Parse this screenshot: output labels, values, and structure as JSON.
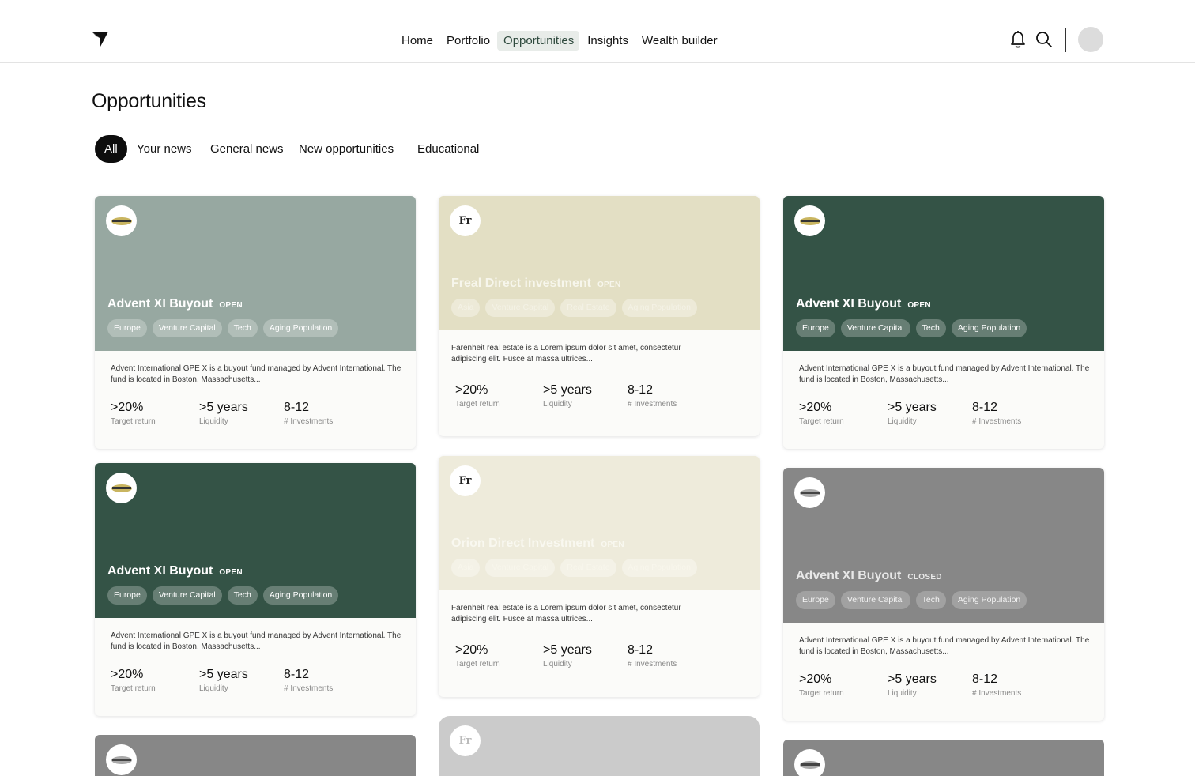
{
  "nav": {
    "items": [
      {
        "label": "Home",
        "active": false
      },
      {
        "label": "Portfolio",
        "active": false
      },
      {
        "label": "Opportunities",
        "active": true
      },
      {
        "label": "Insights",
        "active": false
      },
      {
        "label": "Wealth builder",
        "active": false
      }
    ],
    "icons": {
      "logo": "arrow-logo-icon",
      "notifications": "bell-icon",
      "search": "search-icon"
    }
  },
  "page": {
    "title": "Opportunities"
  },
  "filters": [
    {
      "label": "All",
      "active": true
    },
    {
      "label": "Your news",
      "active": false
    },
    {
      "label": "General news",
      "active": false
    },
    {
      "label": "New opportunities",
      "active": false
    },
    {
      "label": "Educational",
      "active": false
    }
  ],
  "cards": [
    {
      "title": "Advent XI Buyout",
      "status": "OPEN",
      "theme": "#97a8a1",
      "tags": [
        "Europe",
        "Venture Capital",
        "Tech",
        "Aging Population"
      ],
      "description": "Advent International GPE X is a buyout fund managed by Advent International. The fund is located in Boston, Massachusetts...",
      "stats": [
        {
          "value": ">20%",
          "label": "Target return"
        },
        {
          "value": ">5 years",
          "label": "Liquidity"
        },
        {
          "value": "8-12",
          "label": "# Investments"
        }
      ]
    },
    {
      "title": "Freal Direct investment",
      "status": "OPEN",
      "theme": "#e3dfc4",
      "logo_text": "Fr",
      "tags": [
        "Asia",
        "Venture Capital",
        "Real Estate",
        "Aging Population"
      ],
      "description": "Farenheit real estate is a Lorem ipsum dolor sit amet, consectetur adipiscing elit. Fusce at massa ultrices...",
      "stats": [
        {
          "value": ">20%",
          "label": "Target return"
        },
        {
          "value": ">5 years",
          "label": "Liquidity"
        },
        {
          "value": "8-12",
          "label": "# Investments"
        }
      ]
    },
    {
      "title": "Advent XI Buyout",
      "status": "OPEN",
      "theme": "#345346",
      "tags": [
        "Europe",
        "Venture Capital",
        "Tech",
        "Aging Population"
      ],
      "description": "Advent International GPE X is a buyout fund managed by Advent International. The fund is located in Boston, Massachusetts...",
      "stats": [
        {
          "value": ">20%",
          "label": "Target return"
        },
        {
          "value": ">5 years",
          "label": "Liquidity"
        },
        {
          "value": "8-12",
          "label": "# Investments"
        }
      ]
    },
    {
      "title": "Advent XI Buyout",
      "status": "OPEN",
      "theme": "#345346",
      "tags": [
        "Europe",
        "Venture Capital",
        "Tech",
        "Aging Population"
      ],
      "description": "Advent International GPE X is a buyout fund managed by Advent International. The fund is located in Boston, Massachusetts...",
      "stats": [
        {
          "value": ">20%",
          "label": "Target return"
        },
        {
          "value": ">5 years",
          "label": "Liquidity"
        },
        {
          "value": "8-12",
          "label": "# Investments"
        }
      ]
    },
    {
      "title": "Orion Direct Investment",
      "status": "OPEN",
      "theme": "#eeebdb",
      "logo_text": "Fr",
      "tags": [
        "Asia",
        "Venture Capital",
        "Real Estate",
        "Aging Population"
      ],
      "description": "Farenheit real estate is a Lorem ipsum dolor sit amet, consectetur adipiscing elit. Fusce at massa ultrices...",
      "stats": [
        {
          "value": ">20%",
          "label": "Target return"
        },
        {
          "value": ">5 years",
          "label": "Liquidity"
        },
        {
          "value": "8-12",
          "label": "# Investments"
        }
      ]
    },
    {
      "title": "Advent XI Buyout",
      "status": "CLOSED",
      "theme": "#878787",
      "tags": [
        "Europe",
        "Venture Capital",
        "Tech",
        "Aging Population"
      ],
      "description": "Advent International GPE X is a buyout fund managed by Advent International. The fund is located in Boston, Massachusetts...",
      "stats": [
        {
          "value": ">20%",
          "label": "Target return"
        },
        {
          "value": ">5 years",
          "label": "Liquidity"
        },
        {
          "value": "8-12",
          "label": "# Investments"
        }
      ]
    },
    {
      "theme": "#878787"
    },
    {
      "theme": "#cbcbcb",
      "logo_text": "Fr"
    },
    {
      "theme": "#878787"
    }
  ]
}
